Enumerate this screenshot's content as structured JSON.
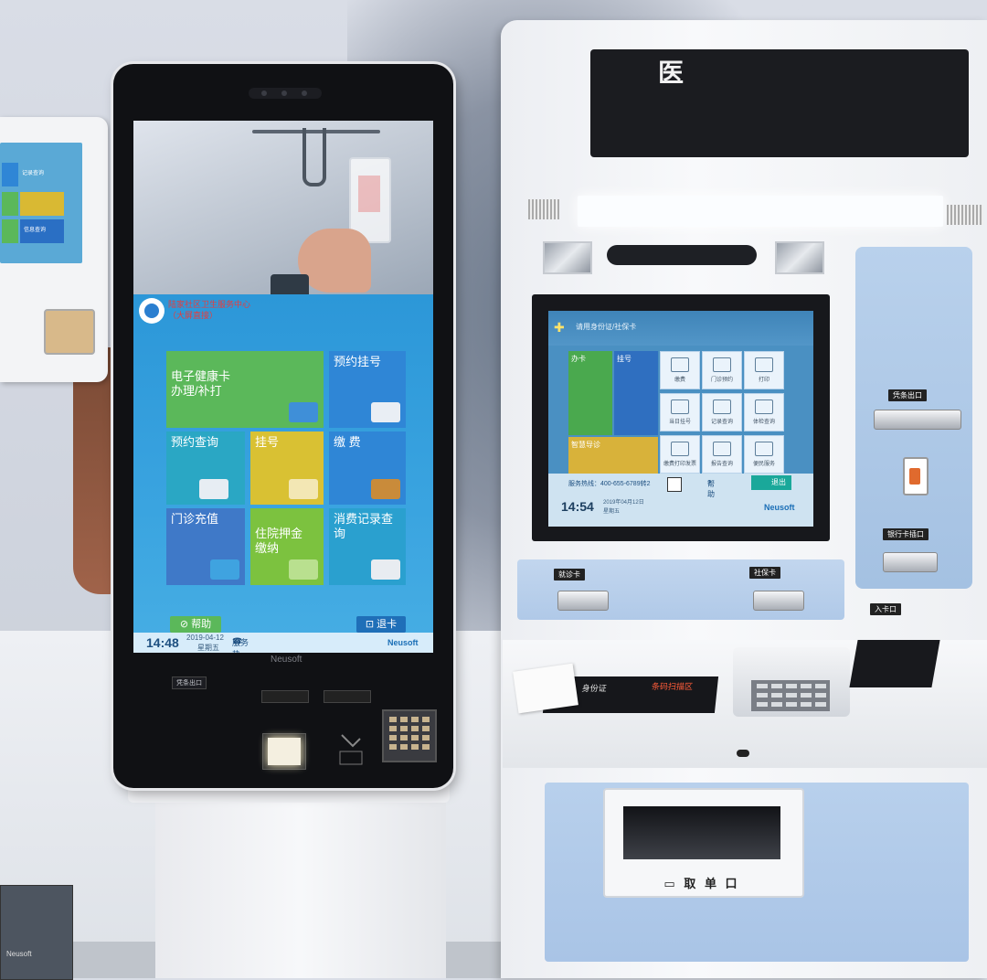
{
  "scene": {
    "background_color": "#d4d8e0"
  },
  "left_kiosk": {
    "ad_tag": "",
    "organization": {
      "line1": "陆家社区卫生服务中心",
      "line2": "（大屏直接）"
    },
    "tiles": [
      {
        "label": "电子健康卡\n办理/补打",
        "color": "#5bb85a",
        "icon": "card-icon"
      },
      {
        "label": "预约挂号",
        "color": "#2f86d6",
        "icon": "doctor-icon"
      },
      {
        "label": "预约查询",
        "color": "#2aa7c4",
        "icon": "ticket-icon"
      },
      {
        "label": "挂号",
        "color": "#d9c133",
        "icon": "bicycle-icon"
      },
      {
        "label": "缴 费",
        "color": "#2f86d6",
        "icon": "wallet-icon"
      },
      {
        "label": "门诊充值",
        "color": "#3f79c8",
        "icon": "coins-card-icon"
      },
      {
        "label": "住院押金\n缴纳",
        "color": "#7cc23f",
        "icon": "hospital-icon"
      },
      {
        "label": "消费记录查询",
        "color": "#2aa0cf",
        "icon": "receipt-icon"
      }
    ],
    "help_button": "帮助",
    "eject_button": "退卡",
    "time": "14:48",
    "date": "2019-04-12",
    "weekday": "星期五",
    "hotline": "服务热线：400-655-6789转2",
    "brand": "Neusoft",
    "bezel_brand": "Neusoft",
    "panel_labels": [
      "凭条出口"
    ],
    "accent_color": "#2c97d8"
  },
  "small_kiosk": {
    "tiles": [
      "记录查询",
      "信息查询"
    ],
    "brand": "Neusoft"
  },
  "right_kiosk": {
    "top_display": "医",
    "screen": {
      "header": "请用身份证/社保卡",
      "tile_big": [
        "办卡",
        "挂号",
        "智慧导诊"
      ],
      "grid": [
        "缴费",
        "门诊预约",
        "打印",
        "当日挂号",
        "记录查询",
        "体检查询",
        "缴费打印发票",
        "报告查询",
        "便民服务"
      ],
      "hotline": "服务热线：400-655-6789转2",
      "time": "14:54",
      "date": "2019年04月12日",
      "weekday": "星期五",
      "help_label": "帮助",
      "exit_label": "退出",
      "brand": "Neusoft"
    },
    "labels": {
      "receipt_exit": "凭条出口",
      "medical_card": "就诊卡",
      "social_card": "社保卡",
      "card_reader": "银行卡插口",
      "document": "身份证",
      "bank_card": "银行卡",
      "insert": "入卡口",
      "scan_area": "条码扫描区",
      "id_card": "身份证"
    },
    "tray_label": "取 单 口",
    "panel_color": "#b4cdea"
  }
}
